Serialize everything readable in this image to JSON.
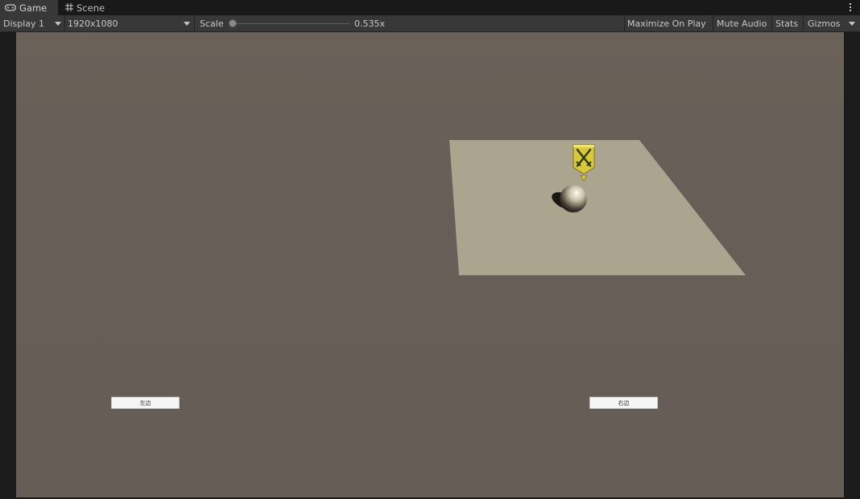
{
  "tabs": [
    {
      "label": "Game",
      "icon": "gamepad-icon"
    },
    {
      "label": "Scene",
      "icon": "grid-icon"
    }
  ],
  "toolbar": {
    "display": "Display 1",
    "resolution": "1920x1080",
    "scale_label": "Scale",
    "scale_value": "0.535x",
    "scale_fraction": 0.02,
    "maximize": "Maximize On Play",
    "mute": "Mute Audio",
    "stats": "Stats",
    "gizmos": "Gizmos"
  },
  "game_ui": {
    "left_button": "左边",
    "right_button": "右边"
  },
  "colors": {
    "background": "#665e57",
    "plane": "#aba48e",
    "marker": "#d9c93a"
  }
}
